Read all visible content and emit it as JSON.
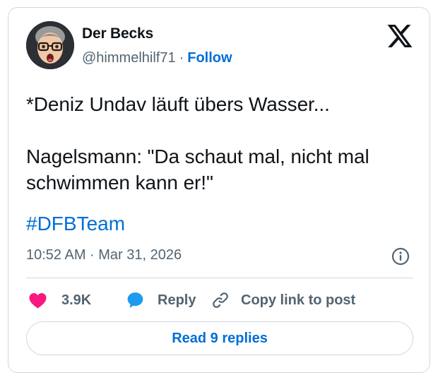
{
  "author": {
    "name": "Der Becks",
    "handle": "@himmelhilf71",
    "separator": "·",
    "follow_label": "Follow"
  },
  "tweet": {
    "line1": "*Deniz Undav läuft übers Wasser...",
    "line2": "Nagelsmann: \"Da schaut mal, nicht mal",
    "line3": "schwimmen kann er!\"",
    "hashtag": "#DFBTeam",
    "timestamp": "10:52 AM · Mar 31, 2026"
  },
  "actions": {
    "like_count": "3.9K",
    "reply_label": "Reply",
    "copy_label": "Copy link to post"
  },
  "footer": {
    "read_replies_label": "Read 9 replies"
  },
  "icons": {
    "brand": "x-logo-icon",
    "like": "heart-icon",
    "reply": "speech-bubble-icon",
    "copy": "link-icon",
    "info": "info-icon"
  },
  "colors": {
    "link_blue": "#006fd6",
    "heart_pink": "#f91880",
    "reply_blue": "#1d9bf0",
    "muted_text": "#536471",
    "border": "#cfd9de"
  }
}
